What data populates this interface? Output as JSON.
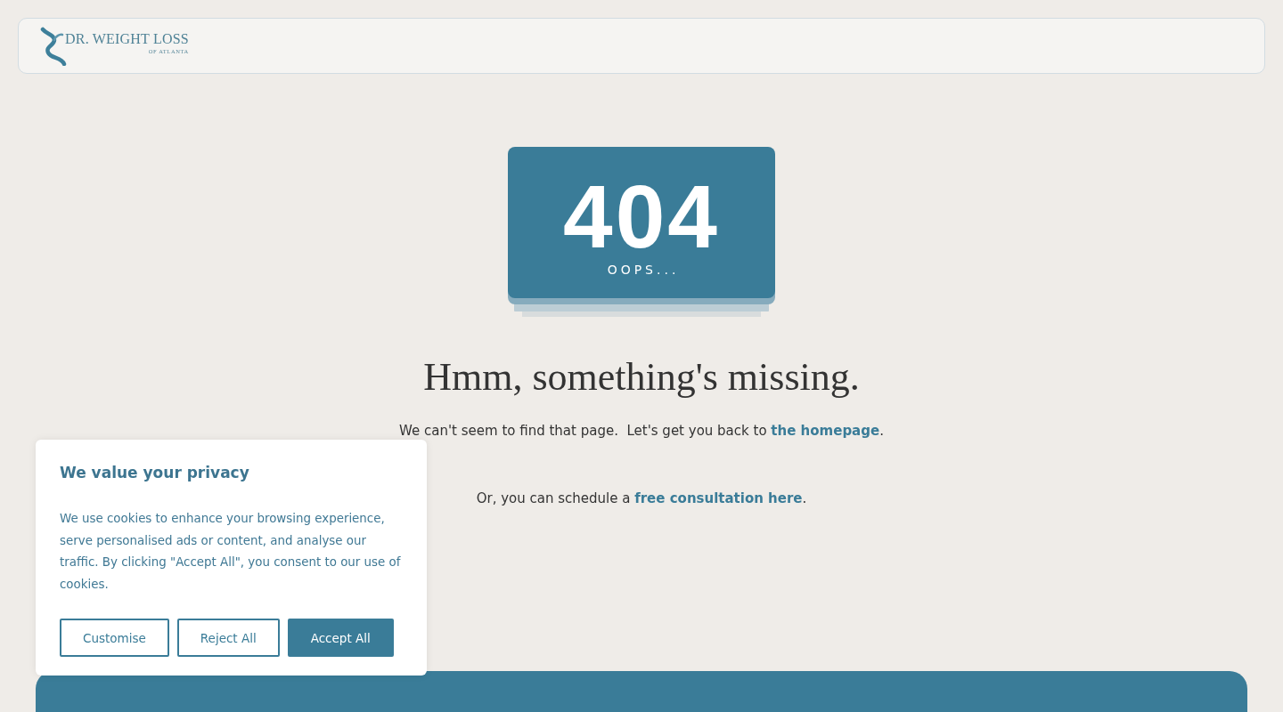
{
  "header": {
    "logo": {
      "title": "DR. WEIGHT LOSS",
      "subtitle": "OF ATLANTA"
    }
  },
  "error_card": {
    "code": "404",
    "caption": "OOPS..."
  },
  "heading": "Hmm, something's missing.",
  "messages": [
    {
      "text": "We can't seem to find that page.  Let's get you back to ",
      "link": "the homepage",
      "after": "."
    },
    {
      "text": "Or, you can schedule a ",
      "link": "free consultation here",
      "after": "."
    }
  ],
  "cookie_banner": {
    "title": "We value your privacy",
    "text_lines": [
      "We use cookies to enhance your browsing experience,",
      "serve personalised ads or content, and analyse our",
      "traffic. By clicking \"Accept All\", you consent to our use of",
      "cookies."
    ],
    "buttons": [
      {
        "label": "Customise",
        "kind": "outline"
      },
      {
        "label": "Reject All",
        "kind": "outline"
      },
      {
        "label": "Accept All",
        "kind": "filled"
      }
    ]
  }
}
